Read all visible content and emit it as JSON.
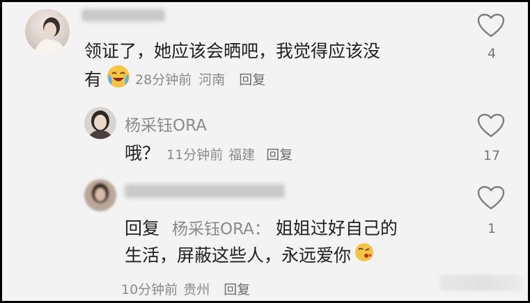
{
  "comments": [
    {
      "text_line1": "领证了，她应该会晒吧，我觉得应该没",
      "text_line2": "有",
      "emoji": "crying-laughing-emoji",
      "time": "28分钟前",
      "location": "河南",
      "reply_label": "回复",
      "likes": "4"
    },
    {
      "username": "杨采钰ORA",
      "text": "哦？",
      "time": "11分钟前",
      "location": "福建",
      "reply_label": "回复",
      "likes": "17"
    },
    {
      "reply_prefix": "回复",
      "reply_to": "杨采钰ORA：",
      "text_line1": "姐姐过好自己的",
      "text_line2": "生活，屏蔽这些人，永远爱你",
      "emoji": "kiss-emoji",
      "time": "10分钟前",
      "location": "贵州",
      "reply_label": "回复",
      "likes": "1"
    }
  ],
  "colors": {
    "background": "#f3f3f3",
    "text": "#1f1f1f",
    "meta": "#8a8a8a"
  }
}
